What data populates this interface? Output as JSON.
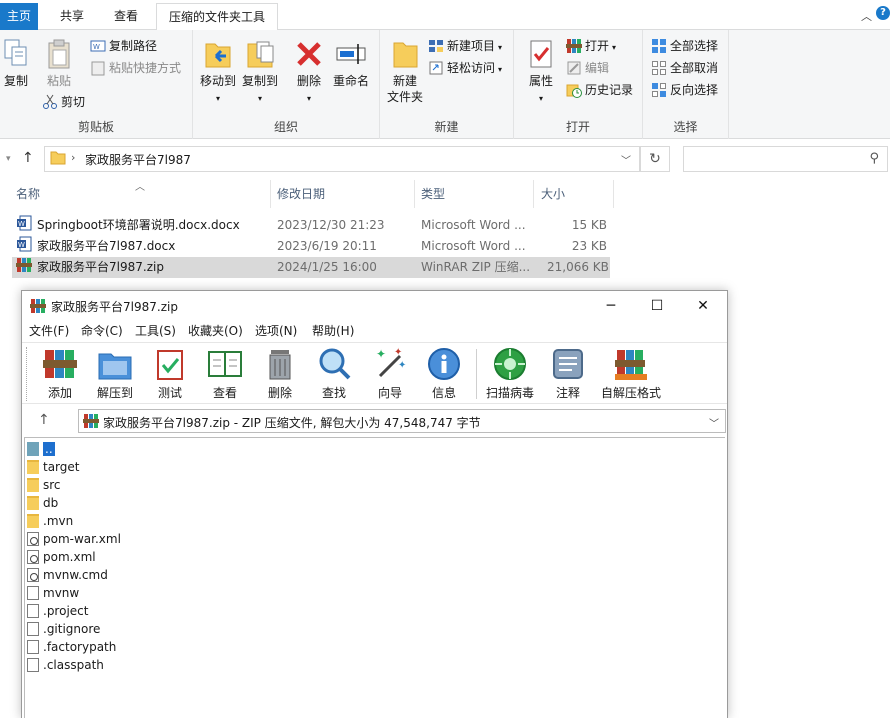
{
  "ribbon_tabs": [
    {
      "label": "主页",
      "active": true
    },
    {
      "label": "共享",
      "active": false
    },
    {
      "label": "查看",
      "active": false
    },
    {
      "label": "压缩的文件夹工具",
      "active": false,
      "contextual": true
    }
  ],
  "ribbon": {
    "clipboard": {
      "label": "剪贴板",
      "copy": "复制",
      "paste": "粘贴",
      "copy_path": "复制路径",
      "paste_shortcut": "粘贴快捷方式",
      "cut": "剪切"
    },
    "organize": {
      "label": "组织",
      "move_to": "移动到",
      "copy_to": "复制到",
      "delete": "删除",
      "rename": "重命名"
    },
    "new": {
      "label": "新建",
      "new_folder_line1": "新建",
      "new_folder_line2": "文件夹",
      "new_item": "新建项目",
      "easy_access": "轻松访问"
    },
    "open": {
      "label": "打开",
      "properties": "属性",
      "open": "打开",
      "edit": "编辑",
      "history": "历史记录"
    },
    "select": {
      "label": "选择",
      "select_all": "全部选择",
      "select_none": "全部取消",
      "invert": "反向选择"
    }
  },
  "address": {
    "path": "家政服务平台7l987",
    "search_placeholder": ""
  },
  "columns": {
    "name": "名称",
    "date": "修改日期",
    "type": "类型",
    "size": "大小"
  },
  "files": [
    {
      "name": "Springboot环境部署说明.docx.docx",
      "date": "2023/12/30 21:23",
      "type": "Microsoft Word ...",
      "size": "15 KB",
      "icon": "word-icon",
      "selected": false
    },
    {
      "name": "家政服务平台7l987.docx",
      "date": "2023/6/19 20:11",
      "type": "Microsoft Word ...",
      "size": "23 KB",
      "icon": "word-icon",
      "selected": false
    },
    {
      "name": "家政服务平台7l987.zip",
      "date": "2024/1/25 16:00",
      "type": "WinRAR ZIP 压缩...",
      "size": "21,066 KB",
      "icon": "winrar-icon",
      "selected": true
    }
  ],
  "winrar": {
    "title": "家政服务平台7l987.zip",
    "menu": [
      "文件(F)",
      "命令(C)",
      "工具(S)",
      "收藏夹(O)",
      "选项(N)",
      "帮助(H)"
    ],
    "toolbar": [
      "添加",
      "解压到",
      "测试",
      "查看",
      "删除",
      "查找",
      "向导",
      "信息",
      "扫描病毒",
      "注释",
      "自解压格式"
    ],
    "address": "家政服务平台7l987.zip - ZIP 压缩文件, 解包大小为 47,548,747 字节",
    "items": [
      {
        "name": "..",
        "kind": "up"
      },
      {
        "name": "target",
        "kind": "folder"
      },
      {
        "name": "src",
        "kind": "folder"
      },
      {
        "name": "db",
        "kind": "folder"
      },
      {
        "name": ".mvn",
        "kind": "folder"
      },
      {
        "name": "pom-war.xml",
        "kind": "config"
      },
      {
        "name": "pom.xml",
        "kind": "config"
      },
      {
        "name": "mvnw.cmd",
        "kind": "config"
      },
      {
        "name": "mvnw",
        "kind": "file"
      },
      {
        "name": ".project",
        "kind": "file"
      },
      {
        "name": ".gitignore",
        "kind": "file"
      },
      {
        "name": ".factorypath",
        "kind": "file"
      },
      {
        "name": ".classpath",
        "kind": "file"
      }
    ]
  },
  "colors": {
    "accent": "#1979ca",
    "selected_row": "#d9d9d9",
    "ribbon_bg": "#f5f6f7"
  }
}
